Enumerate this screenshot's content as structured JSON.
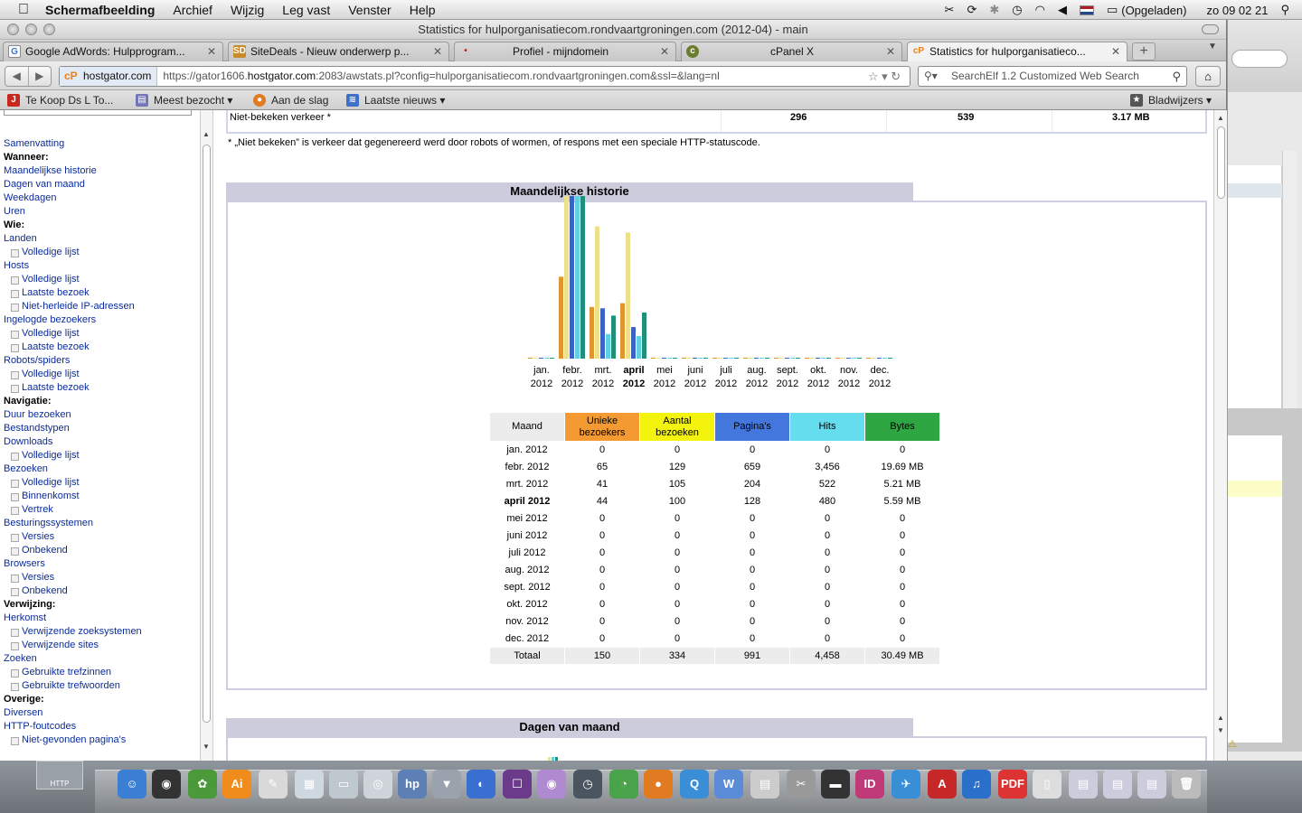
{
  "menubar": {
    "app": "Schermafbeelding",
    "items": [
      "Archief",
      "Wijzig",
      "Leg vast",
      "Venster",
      "Help"
    ],
    "battery": "(Opgeladen)",
    "clock": "zo 09 02 21"
  },
  "window": {
    "title": "Statistics for hulporganisatiecom.rondvaartgroningen.com (2012-04) - main"
  },
  "tabs": [
    {
      "label": "Google AdWords: Hulpprogram...",
      "icon": "google-icon",
      "color": "#3b73d3"
    },
    {
      "label": "SiteDeals - Nieuw onderwerp p...",
      "icon": "sitedeals-icon",
      "color": "#c98a2d"
    },
    {
      "label": "Profiel - mijndomein",
      "icon": "mijndomein-icon",
      "color": "#d01a1a"
    },
    {
      "label": "cPanel X",
      "icon": "cpanel-icon",
      "color": "#6b7d2e"
    },
    {
      "label": "Statistics for hulporganisatieco...",
      "icon": "cp-icon",
      "color": "#e8811a"
    }
  ],
  "urlbar": {
    "site": "hostgator.com",
    "prefix": "https://gator1606.",
    "host": "hostgator.com",
    "rest": ":2083/awstats.pl?config=hulporganisatiecom.rondvaartgroningen.com&ssl=&lang=nl"
  },
  "search": {
    "placeholder": "SearchElf 1.2 Customized Web Search"
  },
  "bookmarks": {
    "items": [
      "Te Koop Ds L To...",
      "Meest bezocht",
      "Aan de slag",
      "Laatste nieuws"
    ],
    "right": "Bladwijzers"
  },
  "sidebar": {
    "items": [
      {
        "text": "Samenvatting",
        "kind": "link"
      },
      {
        "text": "Wanneer:",
        "kind": "heading"
      },
      {
        "text": "Maandelijkse historie",
        "kind": "link"
      },
      {
        "text": "Dagen van maand",
        "kind": "link"
      },
      {
        "text": "Weekdagen",
        "kind": "link"
      },
      {
        "text": "Uren",
        "kind": "link"
      },
      {
        "text": "Wie:",
        "kind": "heading"
      },
      {
        "text": "Landen",
        "kind": "link"
      },
      {
        "text": "Volledige lijst",
        "kind": "sub"
      },
      {
        "text": "Hosts",
        "kind": "link"
      },
      {
        "text": "Volledige lijst",
        "kind": "sub"
      },
      {
        "text": "Laatste bezoek",
        "kind": "sub"
      },
      {
        "text": "Niet-herleide IP-adressen",
        "kind": "sub"
      },
      {
        "text": "Ingelogde bezoekers",
        "kind": "link"
      },
      {
        "text": "Volledige lijst",
        "kind": "sub"
      },
      {
        "text": "Laatste bezoek",
        "kind": "sub"
      },
      {
        "text": "Robots/spiders",
        "kind": "link"
      },
      {
        "text": "Volledige lijst",
        "kind": "sub"
      },
      {
        "text": "Laatste bezoek",
        "kind": "sub"
      },
      {
        "text": "Navigatie:",
        "kind": "heading"
      },
      {
        "text": "Duur bezoeken",
        "kind": "link"
      },
      {
        "text": "Bestandstypen",
        "kind": "link"
      },
      {
        "text": "Downloads",
        "kind": "link"
      },
      {
        "text": "Volledige lijst",
        "kind": "sub"
      },
      {
        "text": "Bezoeken",
        "kind": "link"
      },
      {
        "text": "Volledige lijst",
        "kind": "sub"
      },
      {
        "text": "Binnenkomst",
        "kind": "sub"
      },
      {
        "text": "Vertrek",
        "kind": "sub"
      },
      {
        "text": "Besturingssystemen",
        "kind": "link"
      },
      {
        "text": "Versies",
        "kind": "sub"
      },
      {
        "text": "Onbekend",
        "kind": "sub"
      },
      {
        "text": "Browsers",
        "kind": "link"
      },
      {
        "text": "Versies",
        "kind": "sub"
      },
      {
        "text": "Onbekend",
        "kind": "sub"
      },
      {
        "text": "Verwijzing:",
        "kind": "heading"
      },
      {
        "text": "Herkomst",
        "kind": "link"
      },
      {
        "text": "Verwijzende zoeksystemen",
        "kind": "sub"
      },
      {
        "text": "Verwijzende sites",
        "kind": "sub"
      },
      {
        "text": "Zoeken",
        "kind": "link"
      },
      {
        "text": "Gebruikte trefzinnen",
        "kind": "sub"
      },
      {
        "text": "Gebruikte trefwoorden",
        "kind": "sub"
      },
      {
        "text": "Overige:",
        "kind": "heading"
      },
      {
        "text": "Diversen",
        "kind": "link"
      },
      {
        "text": "HTTP-foutcodes",
        "kind": "link"
      },
      {
        "text": "Niet-gevonden pagina's",
        "kind": "sub"
      }
    ]
  },
  "unviewed": {
    "label": "Niet-bekeken verkeer *",
    "pages": "296",
    "hits": "539",
    "bytes": "3.17 MB",
    "note": "* „Niet bekeken” is verkeer dat gegenereerd werd door robots of wormen, of respons met een speciale HTTP-statuscode."
  },
  "monthly": {
    "title": "Maandelijkse historie",
    "headers": [
      "Maand",
      "Unieke bezoekers",
      "Aantal bezoeken",
      "Pagina's",
      "Hits",
      "Bytes"
    ],
    "rows": [
      [
        "jan. 2012",
        "0",
        "0",
        "0",
        "0",
        "0"
      ],
      [
        "febr. 2012",
        "65",
        "129",
        "659",
        "3,456",
        "19.69 MB"
      ],
      [
        "mrt. 2012",
        "41",
        "105",
        "204",
        "522",
        "5.21 MB"
      ],
      [
        "april 2012",
        "44",
        "100",
        "128",
        "480",
        "5.59 MB"
      ],
      [
        "mei 2012",
        "0",
        "0",
        "0",
        "0",
        "0"
      ],
      [
        "juni 2012",
        "0",
        "0",
        "0",
        "0",
        "0"
      ],
      [
        "juli 2012",
        "0",
        "0",
        "0",
        "0",
        "0"
      ],
      [
        "aug. 2012",
        "0",
        "0",
        "0",
        "0",
        "0"
      ],
      [
        "sept. 2012",
        "0",
        "0",
        "0",
        "0",
        "0"
      ],
      [
        "okt. 2012",
        "0",
        "0",
        "0",
        "0",
        "0"
      ],
      [
        "nov. 2012",
        "0",
        "0",
        "0",
        "0",
        "0"
      ],
      [
        "dec. 2012",
        "0",
        "0",
        "0",
        "0",
        "0"
      ]
    ],
    "total": [
      "Totaal",
      "150",
      "334",
      "991",
      "4,458",
      "30.49 MB"
    ],
    "current_month_index": 3
  },
  "next_section": {
    "title": "Dagen van maand"
  },
  "chart_data": {
    "type": "bar",
    "categories": [
      "jan. 2012",
      "febr. 2012",
      "mrt. 2012",
      "april 2012",
      "mei 2012",
      "juni 2012",
      "juli 2012",
      "aug. 2012",
      "sept. 2012",
      "okt. 2012",
      "nov. 2012",
      "dec. 2012"
    ],
    "category_lines": [
      [
        "jan.",
        "2012"
      ],
      [
        "febr.",
        "2012"
      ],
      [
        "mrt.",
        "2012"
      ],
      [
        "april",
        "2012"
      ],
      [
        "mei",
        "2012"
      ],
      [
        "juni",
        "2012"
      ],
      [
        "juli",
        "2012"
      ],
      [
        "aug.",
        "2012"
      ],
      [
        "sept.",
        "2012"
      ],
      [
        "okt.",
        "2012"
      ],
      [
        "nov.",
        "2012"
      ],
      [
        "dec.",
        "2012"
      ]
    ],
    "series": [
      {
        "values": [
          0,
          65,
          41,
          44,
          0,
          0,
          0,
          0,
          0,
          0,
          0,
          0
        ],
        "color": "#e0962e"
      },
      {
        "values": [
          0,
          129,
          105,
          100,
          0,
          0,
          0,
          0,
          0,
          0,
          0,
          0
        ],
        "color": "#ece08a"
      },
      {
        "values": [
          0,
          659,
          204,
          128,
          0,
          0,
          0,
          0,
          0,
          0,
          0,
          0
        ],
        "color": "#3a62c8"
      },
      {
        "values": [
          0,
          3456,
          522,
          480,
          0,
          0,
          0,
          0,
          0,
          0,
          0,
          0
        ],
        "color": "#5ed0df"
      },
      {
        "values": [
          0,
          19.69,
          5.21,
          5.59,
          0,
          0,
          0,
          0,
          0,
          0,
          0,
          0
        ],
        "color": "#21907a"
      }
    ],
    "grid": false,
    "legend": "none"
  }
}
